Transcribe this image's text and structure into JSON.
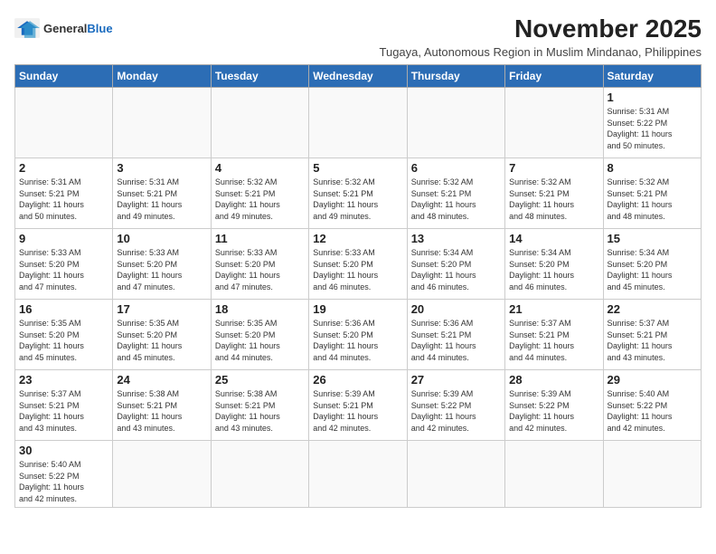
{
  "header": {
    "logo_line1": "General",
    "logo_line2": "Blue",
    "month_year": "November 2025",
    "subtitle": "Tugaya, Autonomous Region in Muslim Mindanao, Philippines"
  },
  "weekdays": [
    "Sunday",
    "Monday",
    "Tuesday",
    "Wednesday",
    "Thursday",
    "Friday",
    "Saturday"
  ],
  "weeks": [
    [
      {
        "day": "",
        "info": ""
      },
      {
        "day": "",
        "info": ""
      },
      {
        "day": "",
        "info": ""
      },
      {
        "day": "",
        "info": ""
      },
      {
        "day": "",
        "info": ""
      },
      {
        "day": "",
        "info": ""
      },
      {
        "day": "1",
        "info": "Sunrise: 5:31 AM\nSunset: 5:22 PM\nDaylight: 11 hours\nand 50 minutes."
      }
    ],
    [
      {
        "day": "2",
        "info": "Sunrise: 5:31 AM\nSunset: 5:21 PM\nDaylight: 11 hours\nand 50 minutes."
      },
      {
        "day": "3",
        "info": "Sunrise: 5:31 AM\nSunset: 5:21 PM\nDaylight: 11 hours\nand 49 minutes."
      },
      {
        "day": "4",
        "info": "Sunrise: 5:32 AM\nSunset: 5:21 PM\nDaylight: 11 hours\nand 49 minutes."
      },
      {
        "day": "5",
        "info": "Sunrise: 5:32 AM\nSunset: 5:21 PM\nDaylight: 11 hours\nand 49 minutes."
      },
      {
        "day": "6",
        "info": "Sunrise: 5:32 AM\nSunset: 5:21 PM\nDaylight: 11 hours\nand 48 minutes."
      },
      {
        "day": "7",
        "info": "Sunrise: 5:32 AM\nSunset: 5:21 PM\nDaylight: 11 hours\nand 48 minutes."
      },
      {
        "day": "8",
        "info": "Sunrise: 5:32 AM\nSunset: 5:21 PM\nDaylight: 11 hours\nand 48 minutes."
      }
    ],
    [
      {
        "day": "9",
        "info": "Sunrise: 5:33 AM\nSunset: 5:20 PM\nDaylight: 11 hours\nand 47 minutes."
      },
      {
        "day": "10",
        "info": "Sunrise: 5:33 AM\nSunset: 5:20 PM\nDaylight: 11 hours\nand 47 minutes."
      },
      {
        "day": "11",
        "info": "Sunrise: 5:33 AM\nSunset: 5:20 PM\nDaylight: 11 hours\nand 47 minutes."
      },
      {
        "day": "12",
        "info": "Sunrise: 5:33 AM\nSunset: 5:20 PM\nDaylight: 11 hours\nand 46 minutes."
      },
      {
        "day": "13",
        "info": "Sunrise: 5:34 AM\nSunset: 5:20 PM\nDaylight: 11 hours\nand 46 minutes."
      },
      {
        "day": "14",
        "info": "Sunrise: 5:34 AM\nSunset: 5:20 PM\nDaylight: 11 hours\nand 46 minutes."
      },
      {
        "day": "15",
        "info": "Sunrise: 5:34 AM\nSunset: 5:20 PM\nDaylight: 11 hours\nand 45 minutes."
      }
    ],
    [
      {
        "day": "16",
        "info": "Sunrise: 5:35 AM\nSunset: 5:20 PM\nDaylight: 11 hours\nand 45 minutes."
      },
      {
        "day": "17",
        "info": "Sunrise: 5:35 AM\nSunset: 5:20 PM\nDaylight: 11 hours\nand 45 minutes."
      },
      {
        "day": "18",
        "info": "Sunrise: 5:35 AM\nSunset: 5:20 PM\nDaylight: 11 hours\nand 44 minutes."
      },
      {
        "day": "19",
        "info": "Sunrise: 5:36 AM\nSunset: 5:20 PM\nDaylight: 11 hours\nand 44 minutes."
      },
      {
        "day": "20",
        "info": "Sunrise: 5:36 AM\nSunset: 5:21 PM\nDaylight: 11 hours\nand 44 minutes."
      },
      {
        "day": "21",
        "info": "Sunrise: 5:37 AM\nSunset: 5:21 PM\nDaylight: 11 hours\nand 44 minutes."
      },
      {
        "day": "22",
        "info": "Sunrise: 5:37 AM\nSunset: 5:21 PM\nDaylight: 11 hours\nand 43 minutes."
      }
    ],
    [
      {
        "day": "23",
        "info": "Sunrise: 5:37 AM\nSunset: 5:21 PM\nDaylight: 11 hours\nand 43 minutes."
      },
      {
        "day": "24",
        "info": "Sunrise: 5:38 AM\nSunset: 5:21 PM\nDaylight: 11 hours\nand 43 minutes."
      },
      {
        "day": "25",
        "info": "Sunrise: 5:38 AM\nSunset: 5:21 PM\nDaylight: 11 hours\nand 43 minutes."
      },
      {
        "day": "26",
        "info": "Sunrise: 5:39 AM\nSunset: 5:21 PM\nDaylight: 11 hours\nand 42 minutes."
      },
      {
        "day": "27",
        "info": "Sunrise: 5:39 AM\nSunset: 5:22 PM\nDaylight: 11 hours\nand 42 minutes."
      },
      {
        "day": "28",
        "info": "Sunrise: 5:39 AM\nSunset: 5:22 PM\nDaylight: 11 hours\nand 42 minutes."
      },
      {
        "day": "29",
        "info": "Sunrise: 5:40 AM\nSunset: 5:22 PM\nDaylight: 11 hours\nand 42 minutes."
      }
    ],
    [
      {
        "day": "30",
        "info": "Sunrise: 5:40 AM\nSunset: 5:22 PM\nDaylight: 11 hours\nand 42 minutes."
      },
      {
        "day": "",
        "info": ""
      },
      {
        "day": "",
        "info": ""
      },
      {
        "day": "",
        "info": ""
      },
      {
        "day": "",
        "info": ""
      },
      {
        "day": "",
        "info": ""
      },
      {
        "day": "",
        "info": ""
      }
    ]
  ]
}
